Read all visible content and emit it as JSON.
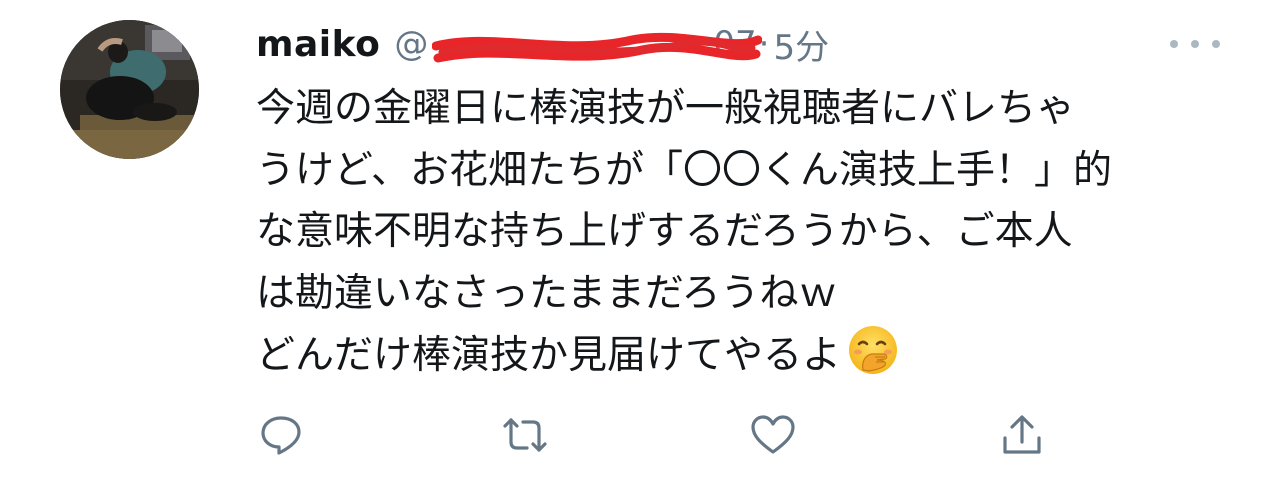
{
  "tweet": {
    "display_name": "maiko",
    "handle_prefix": "@",
    "handle_tail": "07",
    "separator": "·",
    "timestamp": "5分",
    "text_lines": [
      "今週の金曜日に棒演技が一般視聴者にバレちゃ",
      "うけど、お花畑たちが「〇〇くん演技上手！」的",
      "な意味不明な持ち上げするだろうから、ご本人",
      "は勘違いなさったままだろうねｗ",
      "どんだけ棒演技か見届けてやるよ"
    ],
    "emoji": "face-with-hand-over-mouth"
  },
  "actions": {
    "reply": "reply-icon",
    "retweet": "retweet-icon",
    "like": "like-icon",
    "share": "share-icon"
  },
  "colors": {
    "text": "#14171a",
    "secondary": "#657786",
    "scribble": "#e8262a",
    "more_dots": "#aab8c2"
  }
}
